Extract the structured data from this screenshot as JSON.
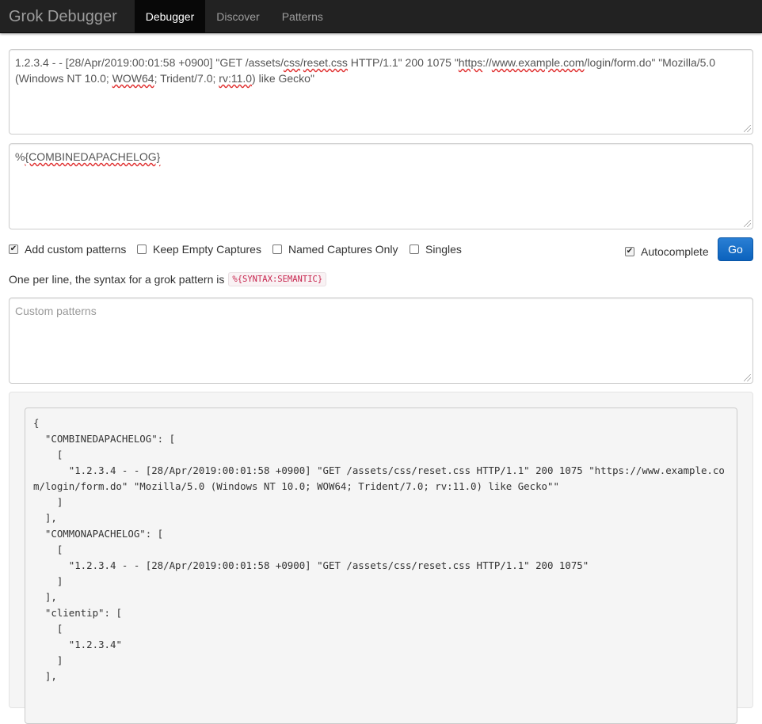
{
  "nav": {
    "brand": "Grok Debugger",
    "items": [
      {
        "label": "Debugger",
        "active": true
      },
      {
        "label": "Discover",
        "active": false
      },
      {
        "label": "Patterns",
        "active": false
      }
    ]
  },
  "input": {
    "log_line_1a": "1.2.3.4 - - [28/Apr/2019:00:01:58 +0900] \"GET /assets/",
    "log_css": "css",
    "log_slash": "/",
    "log_reset": "reset.css",
    "log_line_1b": " HTTP/1.1\" 200 1075 \"",
    "log_https": "https",
    "log_sep": "://",
    "log_host": "www.example.com",
    "log_line_1c": "/login/form.do\" \"Mozilla/5.0",
    "log_line_2a": "(Windows NT 10.0; ",
    "log_wow": "WOW64",
    "log_line_2b": "; Trident/7.0; ",
    "log_rv": "rv:11.0",
    "log_line_2c": ") like Gecko\""
  },
  "pattern": {
    "prefix": "%",
    "value": "{COMBINEDAPACHELOG}"
  },
  "options": {
    "add_custom_patterns": {
      "label": "Add custom patterns",
      "checked": true
    },
    "keep_empty_captures": {
      "label": "Keep Empty Captures",
      "checked": false
    },
    "named_captures_only": {
      "label": "Named Captures Only",
      "checked": false
    },
    "singles": {
      "label": "Singles",
      "checked": false
    },
    "autocomplete": {
      "label": "Autocomplete",
      "checked": true
    },
    "go_label": "Go"
  },
  "help": {
    "text": "One per line, the syntax for a grok pattern is",
    "code": "%{SYNTAX:SEMANTIC}"
  },
  "custom_patterns": {
    "placeholder": "Custom patterns"
  },
  "result": {
    "text": "{\n  \"COMBINEDAPACHELOG\": [\n    [\n      \"1.2.3.4 - - [28/Apr/2019:00:01:58 +0900] \"GET /assets/css/reset.css HTTP/1.1\" 200 1075 \"https://www.example.com/login/form.do\" \"Mozilla/5.0 (Windows NT 10.0; WOW64; Trident/7.0; rv:11.0) like Gecko\"\"\n    ]\n  ],\n  \"COMMONAPACHELOG\": [\n    [\n      \"1.2.3.4 - - [28/Apr/2019:00:01:58 +0900] \"GET /assets/css/reset.css HTTP/1.1\" 200 1075\"\n    ]\n  ],\n  \"clientip\": [\n    [\n      \"1.2.3.4\"\n    ]\n  ],"
  }
}
